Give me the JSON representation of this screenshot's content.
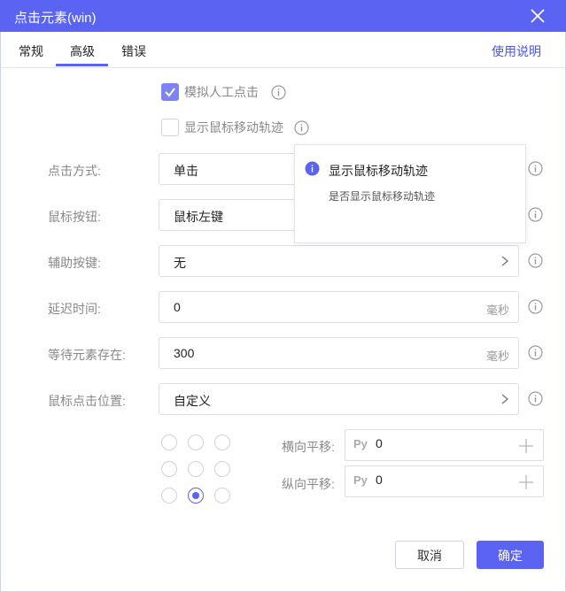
{
  "window": {
    "title": "点击元素(win)"
  },
  "tabs": [
    {
      "label": "常规"
    },
    {
      "label": "高级"
    },
    {
      "label": "错误"
    }
  ],
  "active_tab": "高级",
  "help_link": "使用说明",
  "options": {
    "simulate_click": {
      "label": "模拟人工点击",
      "checked": true
    },
    "show_track": {
      "label": "显示鼠标移动轨迹",
      "checked": false
    }
  },
  "tooltip": {
    "title": "显示鼠标移动轨迹",
    "description": "是否显示鼠标移动轨迹"
  },
  "fields": {
    "click_method": {
      "label": "点击方式:",
      "value": "单击"
    },
    "mouse_button": {
      "label": "鼠标按钮:",
      "value": "鼠标左键"
    },
    "modifier_key": {
      "label": "辅助按键:",
      "value": "无"
    },
    "delay": {
      "label": "延迟时间:",
      "value": "0",
      "unit": "毫秒"
    },
    "wait_exists": {
      "label": "等待元素存在:",
      "value": "300",
      "unit": "毫秒"
    },
    "click_position": {
      "label": "鼠标点击位置:",
      "value": "自定义"
    }
  },
  "position_grid": {
    "selected": "bottom-center"
  },
  "offsets": {
    "horizontal": {
      "label": "横向平移:",
      "prefix": "Py",
      "value": "0"
    },
    "vertical": {
      "label": "纵向平移:",
      "prefix": "Py",
      "value": "0"
    }
  },
  "buttons": {
    "cancel": "取消",
    "ok": "确定"
  },
  "colors": {
    "accent": "#5b63f3",
    "checkbox_checked": "#7d84f2"
  }
}
